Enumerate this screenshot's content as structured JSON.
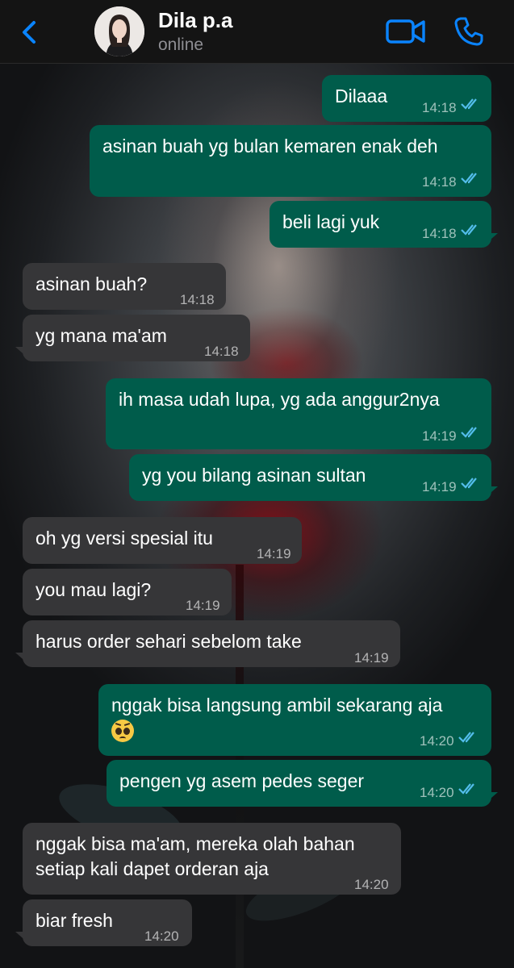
{
  "header": {
    "back_icon": "chevron-left-icon",
    "contact_name": "Dila p.a",
    "status": "online",
    "video_icon": "video-call-icon",
    "phone_icon": "phone-call-icon",
    "accent_color": "#0a84ff"
  },
  "messages": [
    {
      "dir": "out",
      "text": "Dilaaa",
      "time": "14:18",
      "read": true
    },
    {
      "dir": "out",
      "text": "asinan buah yg bulan kemaren enak deh",
      "time": "14:18",
      "read": true
    },
    {
      "dir": "out",
      "text": "beli lagi yuk",
      "time": "14:18",
      "read": true
    },
    {
      "dir": "in",
      "text": "asinan buah?",
      "time": "14:18"
    },
    {
      "dir": "in",
      "text": "yg mana ma'am",
      "time": "14:18"
    },
    {
      "dir": "out",
      "text": "ih masa udah lupa, yg ada anggur2nya",
      "time": "14:19",
      "read": true
    },
    {
      "dir": "out",
      "text": "yg you bilang asinan sultan",
      "time": "14:19",
      "read": true
    },
    {
      "dir": "in",
      "text": "oh yg versi spesial itu",
      "time": "14:19"
    },
    {
      "dir": "in",
      "text": "you mau lagi?",
      "time": "14:19"
    },
    {
      "dir": "in",
      "text": "harus order sehari sebelom take",
      "time": "14:19"
    },
    {
      "dir": "out",
      "text": "nggak bisa langsung ambil sekarang aja",
      "emoji": "pleading-face-emoji",
      "time": "14:20",
      "read": true
    },
    {
      "dir": "out",
      "text": "pengen yg asem pedes seger",
      "time": "14:20",
      "read": true
    },
    {
      "dir": "in",
      "text": "nggak bisa ma'am, mereka olah bahan",
      "text2": "setiap kali dapet orderan aja",
      "time": "14:20"
    },
    {
      "dir": "in",
      "text": "biar fresh",
      "time": "14:20"
    }
  ],
  "colors": {
    "outgoing_bubble": "#005c4b",
    "incoming_bubble": "#363638",
    "read_tick": "#53bdeb"
  }
}
